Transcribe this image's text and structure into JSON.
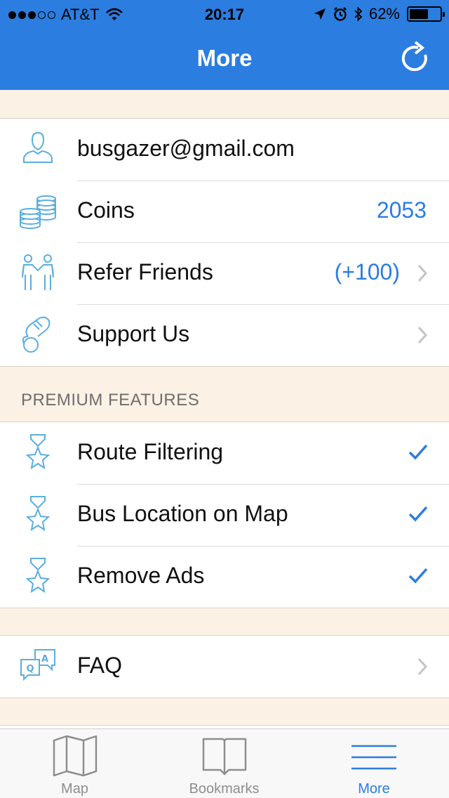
{
  "status_bar": {
    "carrier": "AT&T",
    "signal_bars_filled": 3,
    "signal_bars_total": 5,
    "time": "20:17",
    "battery_percent": "62%",
    "battery_level": 0.62
  },
  "nav": {
    "title": "More",
    "refresh_icon": "refresh-icon"
  },
  "account": {
    "rows": [
      {
        "icon": "user-icon",
        "label": "busgazer@gmail.com"
      },
      {
        "icon": "coins-icon",
        "label": "Coins",
        "value": "2053"
      },
      {
        "icon": "friends-icon",
        "label": "Refer Friends",
        "value": "(+100)"
      },
      {
        "icon": "support-hand-icon",
        "label": "Support Us"
      }
    ]
  },
  "premium": {
    "header": "PREMIUM FEATURES",
    "rows": [
      {
        "icon": "medal-icon",
        "label": "Route Filtering",
        "checked": true
      },
      {
        "icon": "medal-icon",
        "label": "Bus Location on Map",
        "checked": true
      },
      {
        "icon": "medal-icon",
        "label": "Remove Ads",
        "checked": true
      }
    ]
  },
  "help": {
    "rows": [
      {
        "icon": "faq-icon",
        "label": "FAQ"
      }
    ]
  },
  "tabs": [
    {
      "icon": "map-icon",
      "label": "Map",
      "active": false
    },
    {
      "icon": "book-icon",
      "label": "Bookmarks",
      "active": false
    },
    {
      "icon": "menu-icon",
      "label": "More",
      "active": true
    }
  ],
  "colors": {
    "accent": "#2b7de0",
    "background": "#fbf1e4",
    "icon_line": "#5aaee0"
  }
}
